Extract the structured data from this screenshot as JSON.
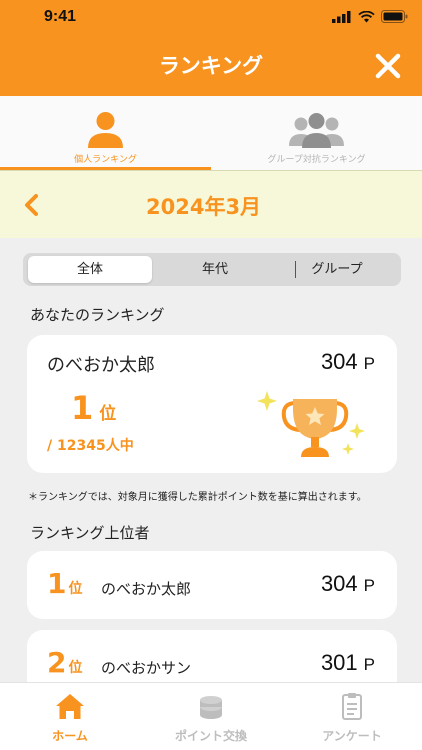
{
  "status_bar": {
    "time": "9:41"
  },
  "header": {
    "title": "ランキング"
  },
  "tabs": [
    {
      "label": "個人ランキング",
      "icon": "person-icon",
      "active": true
    },
    {
      "label": "グループ対抗ランキング",
      "icon": "group-icon",
      "active": false
    }
  ],
  "month": {
    "label": "2024年3月"
  },
  "segments": [
    {
      "label": "全体",
      "active": true
    },
    {
      "label": "年代",
      "active": false
    },
    {
      "label": "グループ",
      "active": false
    }
  ],
  "my_ranking": {
    "section_title": "あなたのランキング",
    "name": "のべおか太郎",
    "points": "304",
    "points_unit": "P",
    "rank": "1",
    "rank_unit": "位",
    "total": "/ 12345人中"
  },
  "note": "＊ランキングでは、対象月に獲得した累計ポイント数を基に算出されます。",
  "top_rankers": {
    "section_title": "ランキング上位者",
    "rows": [
      {
        "rank": "1",
        "rank_unit": "位",
        "name": "のべおか太郎",
        "points": "304",
        "points_unit": "P"
      },
      {
        "rank": "2",
        "rank_unit": "位",
        "name": "のべおかサン",
        "points": "301",
        "points_unit": "P"
      }
    ]
  },
  "tabbar": [
    {
      "label": "ホーム",
      "icon": "home-icon",
      "active": true
    },
    {
      "label": "ポイント交換",
      "icon": "coins-icon",
      "active": false
    },
    {
      "label": "アンケート",
      "icon": "clipboard-icon",
      "active": false
    }
  ],
  "colors": {
    "accent": "#f7931e",
    "month_bar_bg": "#f6f8d9",
    "inactive": "#bdbdbd"
  }
}
